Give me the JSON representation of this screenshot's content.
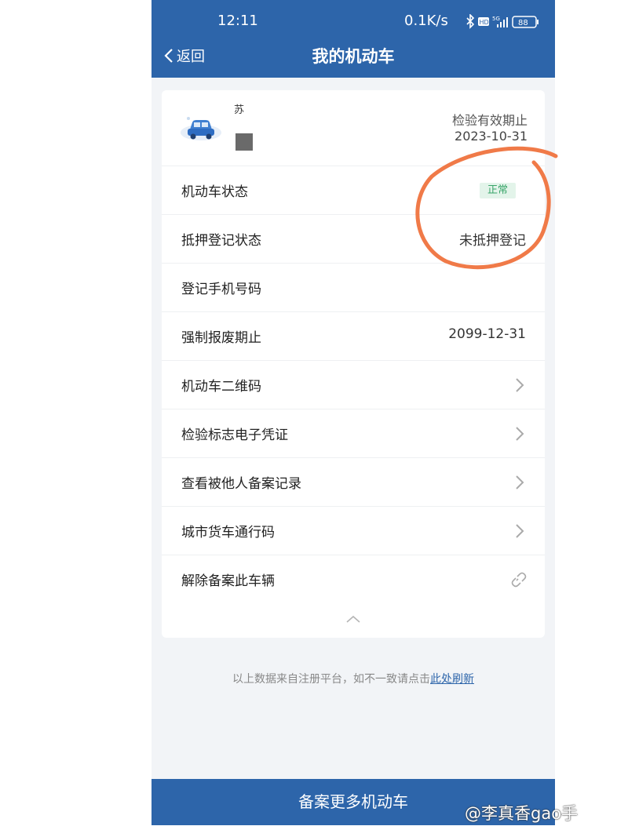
{
  "status_bar": {
    "time": "12:11",
    "network_speed": "0.1K/s",
    "battery": "88"
  },
  "nav": {
    "back_label": "返回",
    "title": "我的机动车"
  },
  "vehicle": {
    "plate_fragment": "苏",
    "inspection_label": "检验有效期止",
    "inspection_date": "2023-10-31"
  },
  "rows": [
    {
      "label": "机动车状态",
      "badge": "正常"
    },
    {
      "label": "抵押登记状态",
      "value": "未抵押登记"
    },
    {
      "label": "登记手机号码",
      "value": ""
    },
    {
      "label": "强制报废期止",
      "value": "2099-12-31"
    },
    {
      "label": "机动车二维码"
    },
    {
      "label": "检验标志电子凭证"
    },
    {
      "label": "查看被他人备案记录"
    },
    {
      "label": "城市货车通行码"
    },
    {
      "label": "解除备案此车辆"
    }
  ],
  "footer": {
    "note": "以上数据来自注册平台，如不一致请点击",
    "link": "此处刷新"
  },
  "bottom_button": "备案更多机动车",
  "watermark": "@李真香gao手",
  "colors": {
    "primary": "#2d65aa",
    "status_green": "#3aa56a",
    "annotation": "#f07a48"
  }
}
